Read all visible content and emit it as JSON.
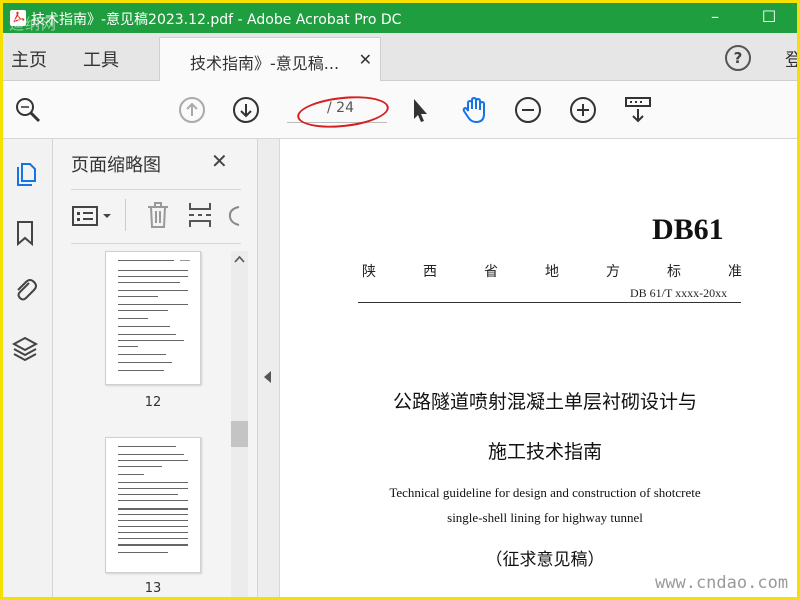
{
  "window": {
    "title": "技术指南》-意见稿2023.12.pdf - Adobe Acrobat Pro DC",
    "watermark_top": "迪纳网",
    "minimize_glyph": "–",
    "maximize_glyph": "☐",
    "titlebar_color": "#1e9e3e",
    "frame_color": "#f5e000"
  },
  "tabs": {
    "home": "主页",
    "tools": "工具",
    "doc_tab": "技术指南》-意见稿...",
    "close_glyph": "✕",
    "help_glyph": "?",
    "login": "登"
  },
  "toolbar": {
    "icons": [
      "zoom-search-icon",
      "page-up-icon",
      "page-down-icon",
      "select-arrow-icon",
      "hand-tool-icon",
      "zoom-out-icon",
      "zoom-in-icon",
      "scroll-mode-icon"
    ],
    "page_current": "",
    "page_total": "/ 24",
    "annotation_color": "#d42020"
  },
  "rail": {
    "icons": [
      "pages-icon",
      "bookmark-icon",
      "attachment-icon",
      "layers-icon"
    ],
    "active_color": "#1473e6"
  },
  "panel": {
    "title": "页面缩略图",
    "close_glyph": "✕",
    "tool_icons": [
      "page-options-icon",
      "delete-page-icon",
      "insert-page-icon",
      "rotate-page-icon"
    ],
    "thumbnails": [
      {
        "label": "12"
      },
      {
        "label": "13"
      }
    ]
  },
  "document": {
    "code": "DB61",
    "standard_chars": [
      "陕",
      "西",
      "省",
      "地",
      "方",
      "标",
      "准"
    ],
    "standard_number": "DB 61/T xxxx-20xx",
    "title_cn_line1": "公路隧道喷射混凝土单层衬砌设计与",
    "title_cn_line2": "施工技术指南",
    "title_en_line1": "Technical guideline for design and construction of shotcrete",
    "title_en_line2": "single-shell lining for highway tunnel",
    "draft_label": "（征求意见稿）",
    "watermark_bottom": "www.cndao.com"
  }
}
